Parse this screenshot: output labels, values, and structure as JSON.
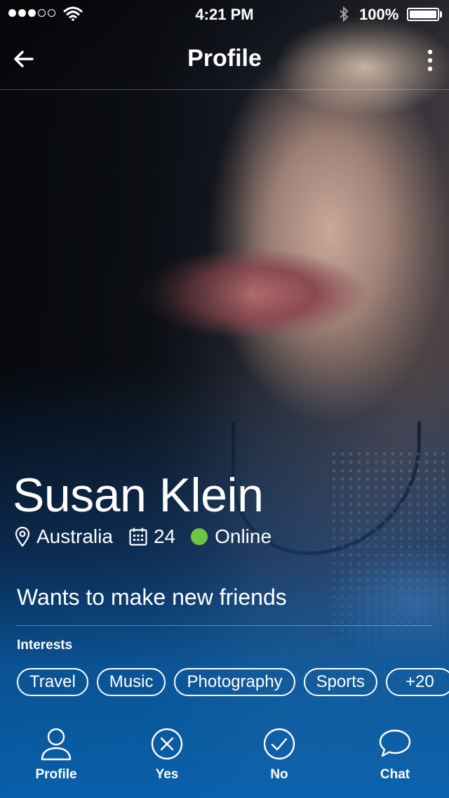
{
  "status_bar": {
    "time": "4:21 PM",
    "battery": "100%",
    "signal_bars_filled": 3,
    "signal_bars_total": 5,
    "battery_level": 1.0,
    "icons": [
      "signal-icon",
      "wifi-icon",
      "bluetooth-icon",
      "battery-icon"
    ]
  },
  "nav": {
    "title": "Profile",
    "back_icon": "arrow-left-icon",
    "more_icon": "more-vertical-icon"
  },
  "profile": {
    "name": "Susan Klein",
    "location": "Australia",
    "age": "24",
    "status": "Online",
    "status_color": "#6cc644",
    "bio": "Wants to make new friends",
    "interests_label": "Interests",
    "interests": [
      "Travel",
      "Music",
      "Photography",
      "Sports",
      "+20"
    ]
  },
  "tabs": [
    {
      "label": "Profile",
      "icon": "user-icon"
    },
    {
      "label": "Yes",
      "icon": "x-circle-icon"
    },
    {
      "label": "No",
      "icon": "check-circle-icon"
    },
    {
      "label": "Chat",
      "icon": "chat-bubble-icon"
    }
  ],
  "colors": {
    "accent_blue": "#0964b2",
    "online_green": "#6cc644",
    "text": "#ffffff"
  }
}
